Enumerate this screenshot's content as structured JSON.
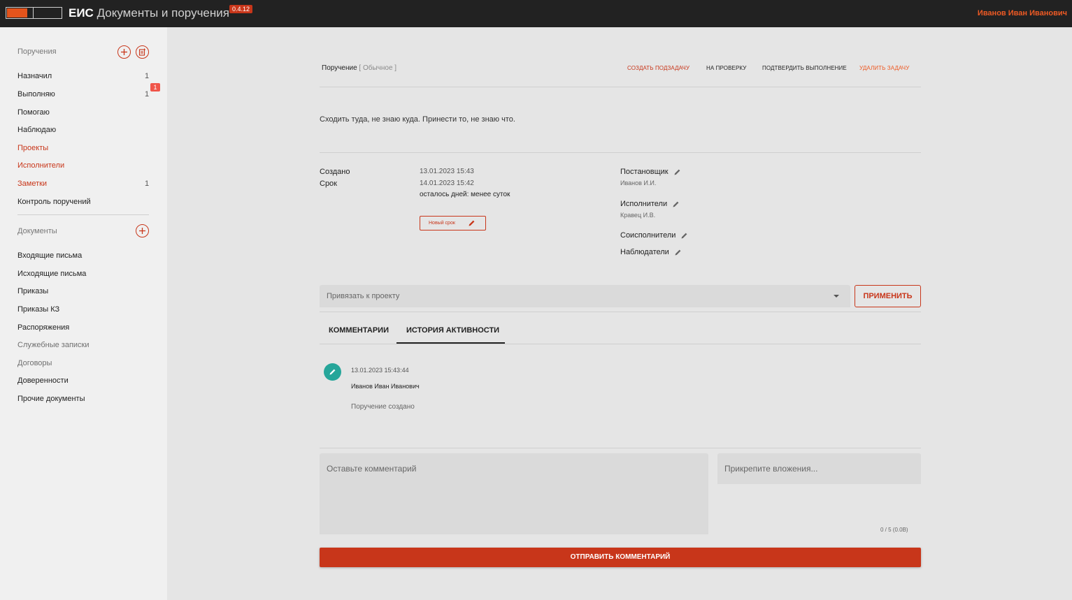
{
  "header": {
    "app_short": "ЕИС",
    "app_title": "Документы и поручения",
    "version": "0.4.12",
    "user_name": "Иванов Иван Иванович"
  },
  "sidebar": {
    "tasks_title": "Поручения",
    "task_items": [
      {
        "label": "Назначил",
        "count": "1"
      },
      {
        "label": "Выполняю",
        "count": "1",
        "badge": "1"
      },
      {
        "label": "Помогаю"
      },
      {
        "label": "Наблюдаю"
      },
      {
        "label": "Проекты"
      },
      {
        "label": "Исполнители"
      },
      {
        "label": "Заметки",
        "count": "1"
      },
      {
        "label": "Контроль поручений"
      }
    ],
    "docs_title": "Документы",
    "doc_items": [
      {
        "label": "Входящие письма"
      },
      {
        "label": "Исходящие письма"
      },
      {
        "label": "Приказы"
      },
      {
        "label": "Приказы КЗ"
      },
      {
        "label": "Распоряжения"
      },
      {
        "label": "Служебные записки"
      },
      {
        "label": "Договоры"
      },
      {
        "label": "Доверенности"
      },
      {
        "label": "Прочие документы"
      }
    ]
  },
  "task": {
    "type_label": "Поручение",
    "kind_label": "[ Обычное ]",
    "actions": {
      "create_subtask": "создать подзадачу",
      "to_review": "на проверку",
      "confirm": "подтвердить выполнение",
      "delete": "удалить задачу"
    },
    "description": "Сходить туда, не знаю куда. Принести то, не знаю что.",
    "created_label": "Создано",
    "created_value": "13.01.2023 15:43",
    "deadline_label": "Срок",
    "deadline_value": "14.01.2023 15:42",
    "remaining": "осталось дней: менее суток",
    "new_deadline_button": "Новый срок",
    "author_label": "Постановщик",
    "author_value": "Иванов И.И.",
    "executors_label": "Исполнители",
    "executors_value": "Кравец И.В.",
    "coexecutors_label": "Соисполнители",
    "observers_label": "Наблюдатели"
  },
  "project": {
    "placeholder": "Привязать к проекту",
    "apply": "ПРИМЕНИТЬ"
  },
  "tabs": {
    "comments": "КОММЕНТАРИИ",
    "history": "ИСТОРИЯ АКТИВНОСТИ"
  },
  "activity": {
    "time": "13.01.2023 15:43:44",
    "user": "Иванов Иван Иванович",
    "text": "Поручение создано"
  },
  "comment_form": {
    "comment_placeholder": "Оставьте комментарий",
    "attach_placeholder": "Прикрепите вложения...",
    "attach_count": "0 / 5 (0.0B)",
    "send": "ОТПРАВИТЬ КОММЕНТАРИЙ"
  },
  "colors": {
    "accent": "#c8361a",
    "header_bg": "#222222",
    "user_name": "#ee5a24",
    "avatar": "#26a69a"
  }
}
